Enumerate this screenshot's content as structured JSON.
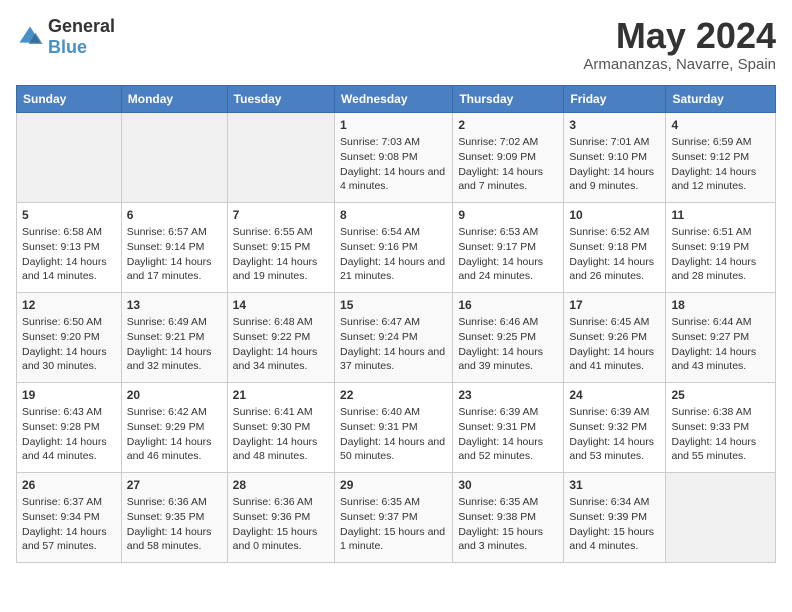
{
  "logo": {
    "text_general": "General",
    "text_blue": "Blue"
  },
  "header": {
    "title": "May 2024",
    "subtitle": "Armananzas, Navarre, Spain"
  },
  "weekdays": [
    "Sunday",
    "Monday",
    "Tuesday",
    "Wednesday",
    "Thursday",
    "Friday",
    "Saturday"
  ],
  "weeks": [
    [
      {
        "day": "",
        "empty": true
      },
      {
        "day": "",
        "empty": true
      },
      {
        "day": "",
        "empty": true
      },
      {
        "day": "1",
        "sunrise": "Sunrise: 7:03 AM",
        "sunset": "Sunset: 9:08 PM",
        "daylight": "Daylight: 14 hours and 4 minutes."
      },
      {
        "day": "2",
        "sunrise": "Sunrise: 7:02 AM",
        "sunset": "Sunset: 9:09 PM",
        "daylight": "Daylight: 14 hours and 7 minutes."
      },
      {
        "day": "3",
        "sunrise": "Sunrise: 7:01 AM",
        "sunset": "Sunset: 9:10 PM",
        "daylight": "Daylight: 14 hours and 9 minutes."
      },
      {
        "day": "4",
        "sunrise": "Sunrise: 6:59 AM",
        "sunset": "Sunset: 9:12 PM",
        "daylight": "Daylight: 14 hours and 12 minutes."
      }
    ],
    [
      {
        "day": "5",
        "sunrise": "Sunrise: 6:58 AM",
        "sunset": "Sunset: 9:13 PM",
        "daylight": "Daylight: 14 hours and 14 minutes."
      },
      {
        "day": "6",
        "sunrise": "Sunrise: 6:57 AM",
        "sunset": "Sunset: 9:14 PM",
        "daylight": "Daylight: 14 hours and 17 minutes."
      },
      {
        "day": "7",
        "sunrise": "Sunrise: 6:55 AM",
        "sunset": "Sunset: 9:15 PM",
        "daylight": "Daylight: 14 hours and 19 minutes."
      },
      {
        "day": "8",
        "sunrise": "Sunrise: 6:54 AM",
        "sunset": "Sunset: 9:16 PM",
        "daylight": "Daylight: 14 hours and 21 minutes."
      },
      {
        "day": "9",
        "sunrise": "Sunrise: 6:53 AM",
        "sunset": "Sunset: 9:17 PM",
        "daylight": "Daylight: 14 hours and 24 minutes."
      },
      {
        "day": "10",
        "sunrise": "Sunrise: 6:52 AM",
        "sunset": "Sunset: 9:18 PM",
        "daylight": "Daylight: 14 hours and 26 minutes."
      },
      {
        "day": "11",
        "sunrise": "Sunrise: 6:51 AM",
        "sunset": "Sunset: 9:19 PM",
        "daylight": "Daylight: 14 hours and 28 minutes."
      }
    ],
    [
      {
        "day": "12",
        "sunrise": "Sunrise: 6:50 AM",
        "sunset": "Sunset: 9:20 PM",
        "daylight": "Daylight: 14 hours and 30 minutes."
      },
      {
        "day": "13",
        "sunrise": "Sunrise: 6:49 AM",
        "sunset": "Sunset: 9:21 PM",
        "daylight": "Daylight: 14 hours and 32 minutes."
      },
      {
        "day": "14",
        "sunrise": "Sunrise: 6:48 AM",
        "sunset": "Sunset: 9:22 PM",
        "daylight": "Daylight: 14 hours and 34 minutes."
      },
      {
        "day": "15",
        "sunrise": "Sunrise: 6:47 AM",
        "sunset": "Sunset: 9:24 PM",
        "daylight": "Daylight: 14 hours and 37 minutes."
      },
      {
        "day": "16",
        "sunrise": "Sunrise: 6:46 AM",
        "sunset": "Sunset: 9:25 PM",
        "daylight": "Daylight: 14 hours and 39 minutes."
      },
      {
        "day": "17",
        "sunrise": "Sunrise: 6:45 AM",
        "sunset": "Sunset: 9:26 PM",
        "daylight": "Daylight: 14 hours and 41 minutes."
      },
      {
        "day": "18",
        "sunrise": "Sunrise: 6:44 AM",
        "sunset": "Sunset: 9:27 PM",
        "daylight": "Daylight: 14 hours and 43 minutes."
      }
    ],
    [
      {
        "day": "19",
        "sunrise": "Sunrise: 6:43 AM",
        "sunset": "Sunset: 9:28 PM",
        "daylight": "Daylight: 14 hours and 44 minutes."
      },
      {
        "day": "20",
        "sunrise": "Sunrise: 6:42 AM",
        "sunset": "Sunset: 9:29 PM",
        "daylight": "Daylight: 14 hours and 46 minutes."
      },
      {
        "day": "21",
        "sunrise": "Sunrise: 6:41 AM",
        "sunset": "Sunset: 9:30 PM",
        "daylight": "Daylight: 14 hours and 48 minutes."
      },
      {
        "day": "22",
        "sunrise": "Sunrise: 6:40 AM",
        "sunset": "Sunset: 9:31 PM",
        "daylight": "Daylight: 14 hours and 50 minutes."
      },
      {
        "day": "23",
        "sunrise": "Sunrise: 6:39 AM",
        "sunset": "Sunset: 9:31 PM",
        "daylight": "Daylight: 14 hours and 52 minutes."
      },
      {
        "day": "24",
        "sunrise": "Sunrise: 6:39 AM",
        "sunset": "Sunset: 9:32 PM",
        "daylight": "Daylight: 14 hours and 53 minutes."
      },
      {
        "day": "25",
        "sunrise": "Sunrise: 6:38 AM",
        "sunset": "Sunset: 9:33 PM",
        "daylight": "Daylight: 14 hours and 55 minutes."
      }
    ],
    [
      {
        "day": "26",
        "sunrise": "Sunrise: 6:37 AM",
        "sunset": "Sunset: 9:34 PM",
        "daylight": "Daylight: 14 hours and 57 minutes."
      },
      {
        "day": "27",
        "sunrise": "Sunrise: 6:36 AM",
        "sunset": "Sunset: 9:35 PM",
        "daylight": "Daylight: 14 hours and 58 minutes."
      },
      {
        "day": "28",
        "sunrise": "Sunrise: 6:36 AM",
        "sunset": "Sunset: 9:36 PM",
        "daylight": "Daylight: 15 hours and 0 minutes."
      },
      {
        "day": "29",
        "sunrise": "Sunrise: 6:35 AM",
        "sunset": "Sunset: 9:37 PM",
        "daylight": "Daylight: 15 hours and 1 minute."
      },
      {
        "day": "30",
        "sunrise": "Sunrise: 6:35 AM",
        "sunset": "Sunset: 9:38 PM",
        "daylight": "Daylight: 15 hours and 3 minutes."
      },
      {
        "day": "31",
        "sunrise": "Sunrise: 6:34 AM",
        "sunset": "Sunset: 9:39 PM",
        "daylight": "Daylight: 15 hours and 4 minutes."
      },
      {
        "day": "",
        "empty": true
      }
    ]
  ]
}
